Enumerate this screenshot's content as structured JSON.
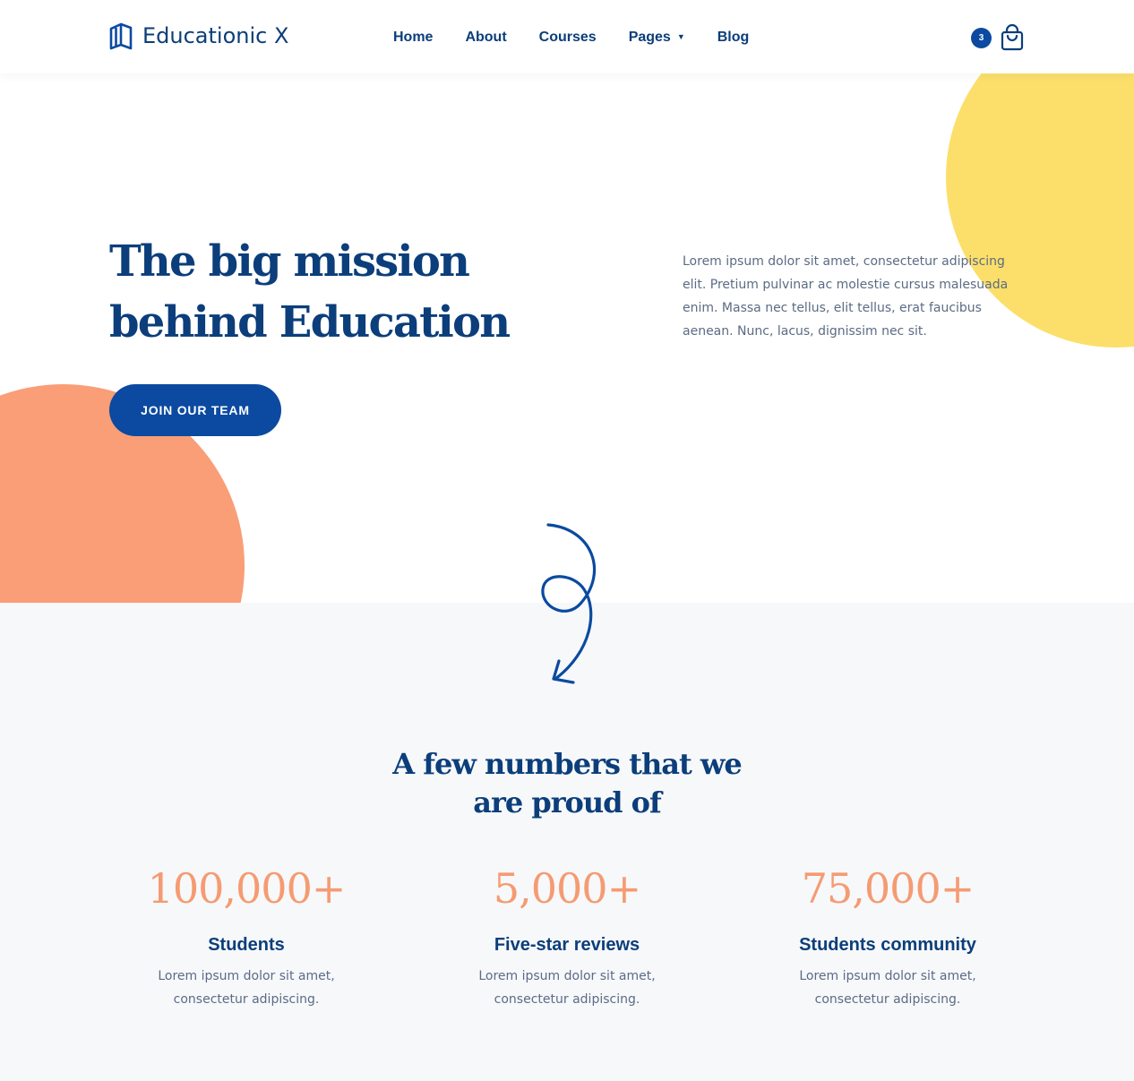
{
  "header": {
    "logo_text": "Educationic X",
    "nav": [
      {
        "label": "Home"
      },
      {
        "label": "About"
      },
      {
        "label": "Courses"
      },
      {
        "label": "Pages"
      },
      {
        "label": "Blog"
      }
    ],
    "cart_count": "3"
  },
  "hero": {
    "title_line1": "The big mission",
    "title_line2": "behind Education",
    "description": "Lorem ipsum dolor sit amet, consectetur adipiscing elit. Pretium pulvinar ac molestie cursus malesuada enim. Massa nec tellus, elit tellus, erat faucibus aenean. Nunc, lacus, dignissim nec sit.",
    "cta_label": "JOIN OUR TEAM"
  },
  "stats": {
    "heading_line1": "A few numbers that we",
    "heading_line2": "are proud of",
    "items": [
      {
        "number": "100,000+",
        "label": "Students",
        "desc": "Lorem ipsum dolor sit amet, consectetur adipiscing."
      },
      {
        "number": "5,000+",
        "label": "Five-star reviews",
        "desc": "Lorem ipsum dolor sit amet, consectetur adipiscing."
      },
      {
        "number": "75,000+",
        "label": "Students community",
        "desc": "Lorem ipsum dolor sit amet, consectetur adipiscing."
      }
    ]
  },
  "colors": {
    "primary": "#0b4aa0",
    "heading": "#0b3e7a",
    "accent_orange": "#f99e77",
    "accent_yellow": "#fcdf6a",
    "section_bg": "#f7f8fa"
  },
  "icons": {
    "logo": "book-icon",
    "cart": "shopping-bag-icon",
    "nav_dropdown": "caret-down-icon",
    "decoration": "squiggle-arrow-icon"
  }
}
